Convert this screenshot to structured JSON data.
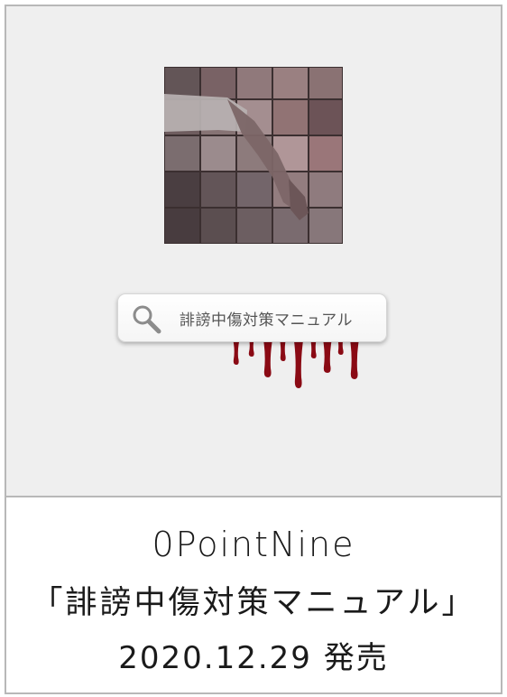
{
  "artwork": {
    "search_query": "誹謗中傷対策マニュアル",
    "icons": {
      "search": "search-icon"
    },
    "colors": {
      "background": "#efefef",
      "blood": "#8a0a14",
      "tile": "#a68d8f"
    }
  },
  "caption": {
    "artist": "0PointNine",
    "title": "「誹謗中傷対策マニュアル」",
    "release_date": "2020.12.29 発売"
  }
}
